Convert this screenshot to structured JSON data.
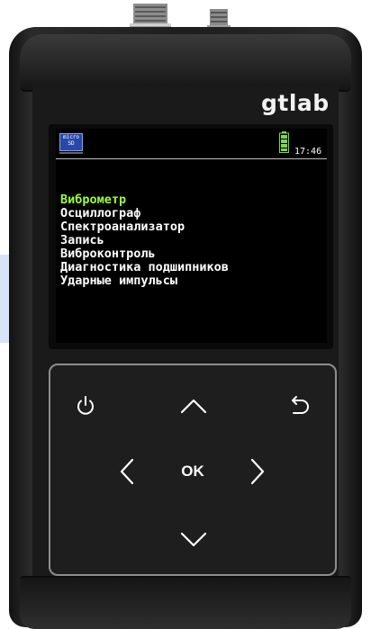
{
  "device": {
    "brand": "gtlab",
    "status_bar": {
      "sd_label": "micro SD",
      "time": "17:46"
    }
  },
  "menu": {
    "items": [
      {
        "label": "Виброметр",
        "selected": true
      },
      {
        "label": "Осциллограф",
        "selected": false
      },
      {
        "label": "Спектроанализатор",
        "selected": false
      },
      {
        "label": "Запись",
        "selected": false
      },
      {
        "label": "Виброконтроль",
        "selected": false
      },
      {
        "label": "Диагностика подшипников",
        "selected": false
      },
      {
        "label": "Ударные импульсы",
        "selected": false
      }
    ]
  },
  "keypad": {
    "ok_label": "OK",
    "icons": {
      "power": "power-icon",
      "up": "chevron-up-icon",
      "back": "back-arrow-icon",
      "left": "chevron-left-icon",
      "right": "chevron-right-icon",
      "down": "chevron-down-icon"
    }
  },
  "colors": {
    "selected_item": "#9cff3c",
    "menu_text": "#ffffff",
    "screen_bg": "#000000",
    "body": "#1e1e1e",
    "keypad_border": "#8e8e8e"
  }
}
